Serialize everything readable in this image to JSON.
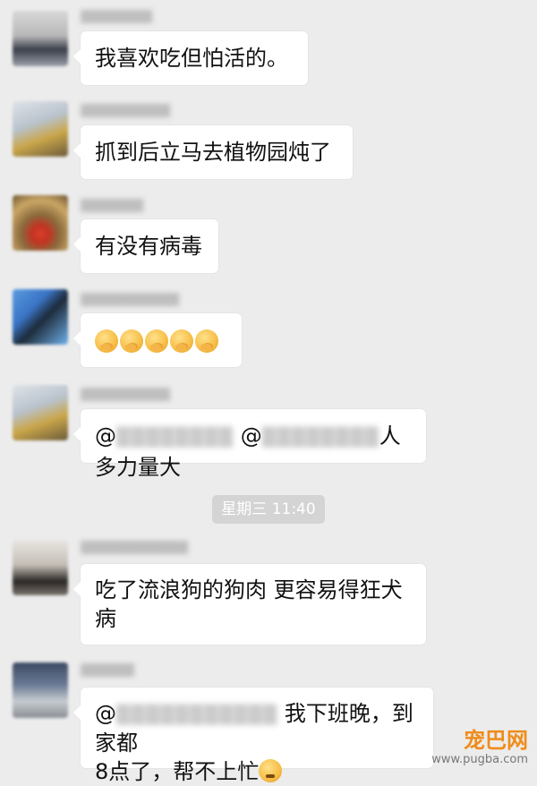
{
  "messages": [
    {
      "name": "",
      "text": "我喜欢吃但怕活的。"
    },
    {
      "name": "",
      "text": "抓到后立马去植物园炖了"
    },
    {
      "name": "",
      "text": "有没有病毒"
    },
    {
      "name": "",
      "emoji_count": 5
    },
    {
      "name": "",
      "at1": "@",
      "at2": "@",
      "text": "人多力量大"
    },
    {
      "name": "",
      "text_line1": "吃了流浪狗的狗肉 更容易得狂犬",
      "text_line2": "病"
    },
    {
      "name": "",
      "at": "@",
      "text_line1": "我下班晚，到家都",
      "text_line2": "8点了，帮不上忙"
    }
  ],
  "timestamp": "星期三 11:40",
  "watermark": {
    "logo": "宠巴网",
    "url": "www.pugba.com"
  },
  "colors": {
    "background": "#ececec",
    "bubble": "#ffffff",
    "watermark": "#f08c1a"
  }
}
